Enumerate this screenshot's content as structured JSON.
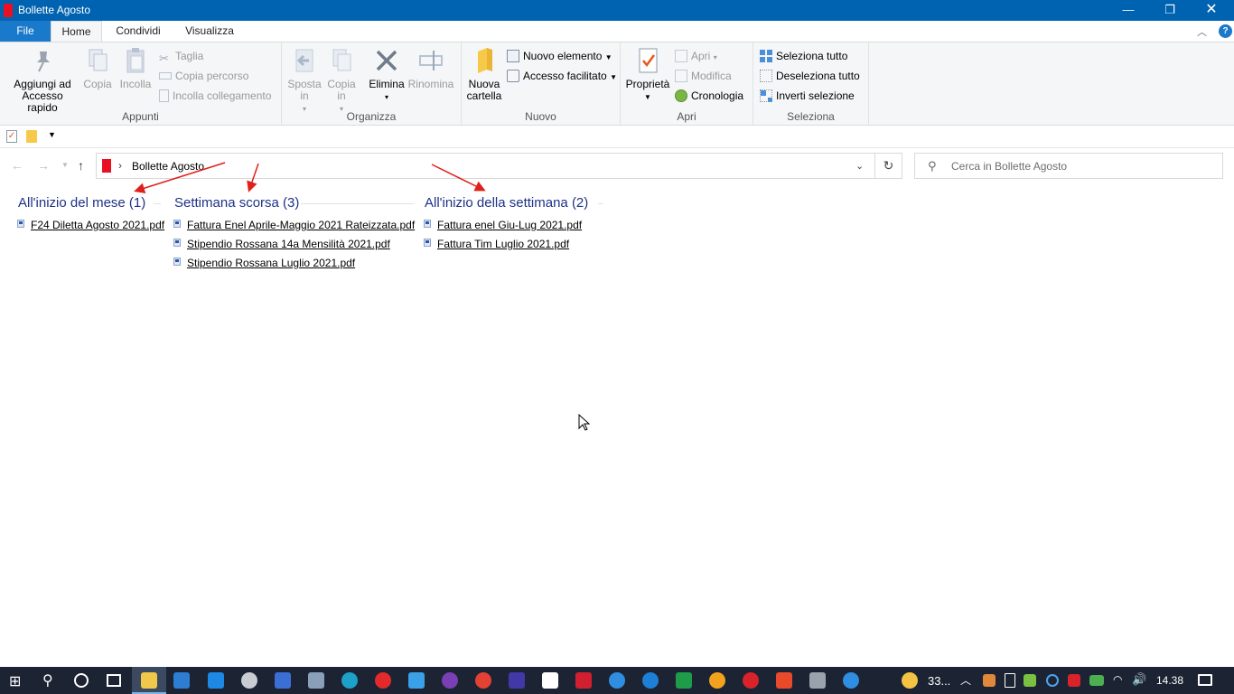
{
  "window": {
    "title": "Bollette Agosto",
    "minimize": "—",
    "maximize": "❐",
    "close": "✕"
  },
  "ribbon_tabs": {
    "file": "File",
    "home": "Home",
    "share": "Condividi",
    "view": "Visualizza"
  },
  "ribbon": {
    "appunti": {
      "label": "Appunti",
      "pin": "Aggiungi ad Accesso rapido",
      "copy": "Copia",
      "paste": "Incolla",
      "cut": "Taglia",
      "copy_path": "Copia percorso",
      "paste_shortcut": "Incolla collegamento"
    },
    "organizza": {
      "label": "Organizza",
      "move_to": "Sposta in",
      "copy_to": "Copia in",
      "delete": "Elimina",
      "rename": "Rinomina"
    },
    "nuovo": {
      "label": "Nuovo",
      "new_folder": "Nuova cartella",
      "new_item": "Nuovo elemento",
      "easy_access": "Accesso facilitato"
    },
    "apri": {
      "label": "Apri",
      "properties": "Proprietà",
      "open": "Apri",
      "edit": "Modifica",
      "history": "Cronologia"
    },
    "seleziona": {
      "label": "Seleziona",
      "select_all": "Seleziona tutto",
      "select_none": "Deseleziona tutto",
      "invert": "Inverti selezione"
    }
  },
  "address": {
    "path": "Bollette Agosto",
    "separator": "›"
  },
  "search": {
    "placeholder": "Cerca in Bollette Agosto"
  },
  "groups": [
    {
      "header": "All'inizio del mese (1)",
      "files": [
        "F24 Diletta Agosto 2021.pdf"
      ]
    },
    {
      "header": "Settimana scorsa (3)",
      "files": [
        "Fattura Enel  Aprile-Maggio 2021 Rateizzata.pdf",
        "Stipendio Rossana 14a Mensilità 2021.pdf",
        "Stipendio Rossana Luglio 2021.pdf"
      ]
    },
    {
      "header": "All'inizio della settimana (2)",
      "files": [
        "Fattura enel Giu-Lug 2021.pdf",
        "Fattura Tim Luglio 2021.pdf"
      ]
    }
  ],
  "taskbar": {
    "weather": "33...",
    "time": "14.38"
  },
  "colors": {
    "titlebar": "#0063b1",
    "group_header": "#1e3287",
    "annotation_arrow": "#e0201b"
  }
}
